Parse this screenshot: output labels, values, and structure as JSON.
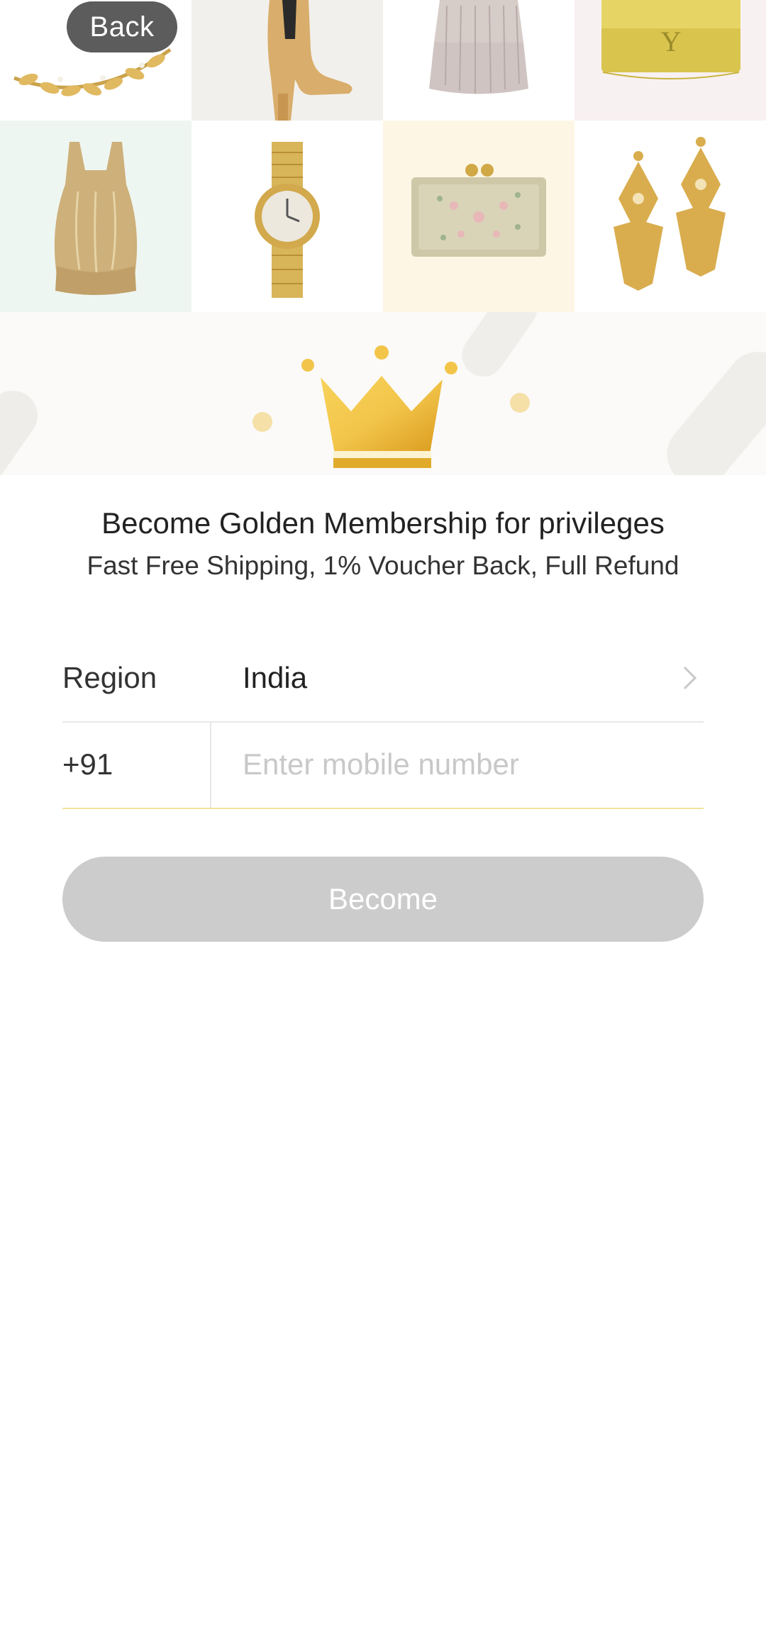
{
  "header": {
    "back_label": "Back"
  },
  "gallery": {
    "items": [
      "gold-leaf-headpiece",
      "gold-ankle-boot",
      "sequin-fringe-dress",
      "gold-clutch-bag",
      "gold-satin-top",
      "gold-wristwatch",
      "embellished-box-clutch",
      "gold-chandelier-earrings"
    ]
  },
  "promo": {
    "title": "Become Golden Membership for privileges",
    "subtitle": "Fast Free Shipping, 1% Voucher Back, Full Refund",
    "icon": "crown-icon"
  },
  "form": {
    "region_label": "Region",
    "region_value": "India",
    "country_code": "+91",
    "mobile_placeholder": "Enter mobile number",
    "mobile_value": ""
  },
  "actions": {
    "become_label": "Become"
  },
  "colors": {
    "accent_gold": "#f2c54a",
    "button_disabled": "#cccccc",
    "input_underline": "#f2e39b"
  }
}
